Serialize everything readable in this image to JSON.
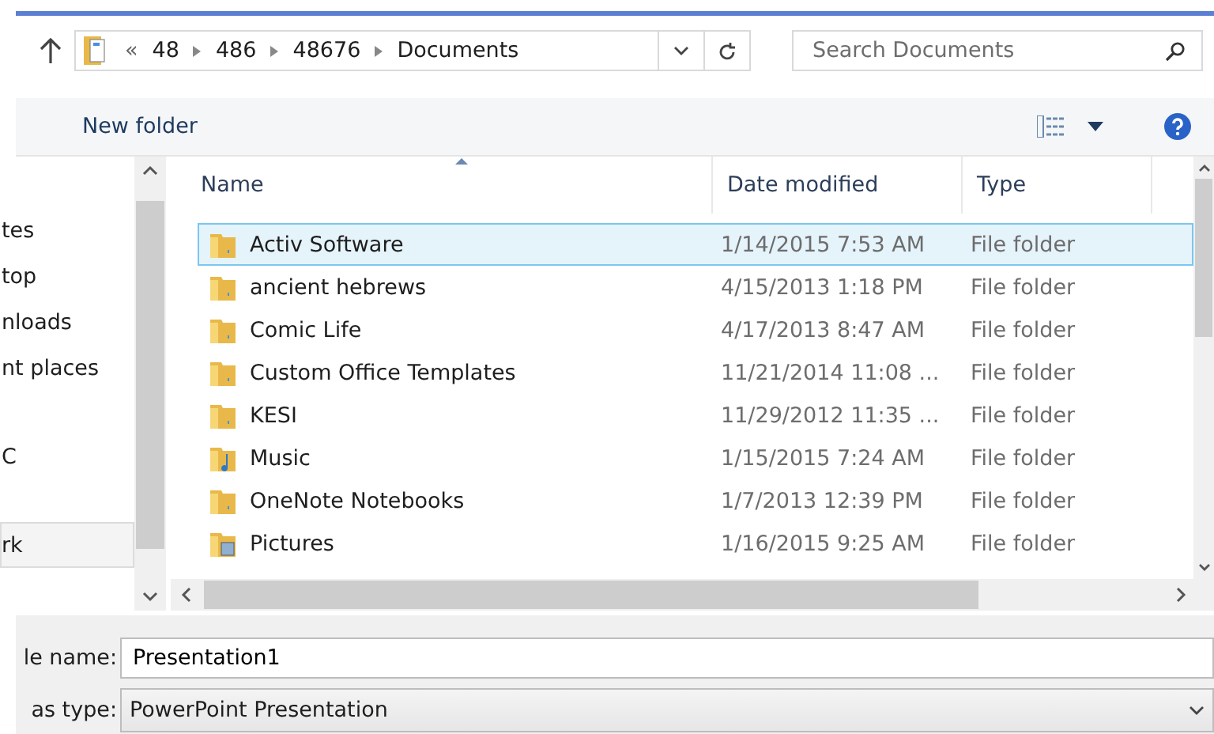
{
  "address_bar": {
    "overflow": "«",
    "crumbs": [
      "48",
      "486",
      "48676",
      "Documents"
    ]
  },
  "search": {
    "placeholder": "Search Documents"
  },
  "toolbar": {
    "new_folder": "New folder"
  },
  "nav_pane": {
    "items": [
      {
        "label": "tes",
        "selected": false
      },
      {
        "label": "top",
        "selected": false
      },
      {
        "label": "nloads",
        "selected": false
      },
      {
        "label": "nt places",
        "selected": false
      },
      {
        "label": "C",
        "selected": false
      },
      {
        "label": "rk",
        "selected": true
      }
    ]
  },
  "table": {
    "columns": [
      "Name",
      "Date modified",
      "Type"
    ],
    "rows": [
      {
        "name": "Activ Software",
        "date": "1/14/2015 7:53 AM",
        "type": "File folder",
        "kind": "folder",
        "selected": true
      },
      {
        "name": "ancient hebrews",
        "date": "4/15/2013 1:18 PM",
        "type": "File folder",
        "kind": "folder",
        "selected": false
      },
      {
        "name": "Comic Life",
        "date": "4/17/2013 8:47 AM",
        "type": "File folder",
        "kind": "folder",
        "selected": false
      },
      {
        "name": "Custom Office Templates",
        "date": "11/21/2014 11:08 ...",
        "type": "File folder",
        "kind": "folder",
        "selected": false
      },
      {
        "name": "KESI",
        "date": "11/29/2012 11:35 ...",
        "type": "File folder",
        "kind": "folder",
        "selected": false
      },
      {
        "name": "Music",
        "date": "1/15/2015 7:24 AM",
        "type": "File folder",
        "kind": "music",
        "selected": false
      },
      {
        "name": "OneNote Notebooks",
        "date": "1/7/2013 12:39 PM",
        "type": "File folder",
        "kind": "folder",
        "selected": false
      },
      {
        "name": "Pictures",
        "date": "1/16/2015 9:25 AM",
        "type": "File folder",
        "kind": "pictures",
        "selected": false
      }
    ]
  },
  "file_name": {
    "label": "le name:",
    "value": "Presentation1"
  },
  "save_as_type": {
    "label": "as type:",
    "value": "PowerPoint Presentation"
  }
}
